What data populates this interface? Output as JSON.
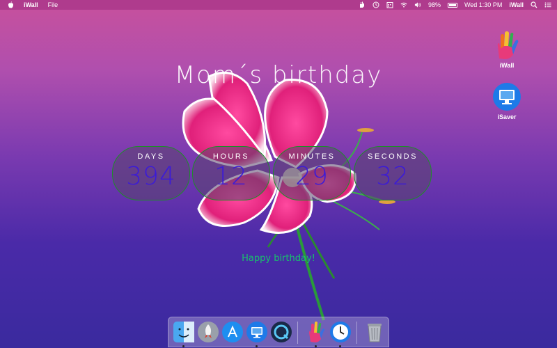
{
  "menubar": {
    "apple_icon": "apple-icon",
    "app_name": "iWall",
    "menus": [
      "File"
    ],
    "status": {
      "battery": "98%",
      "clock": "Wed 1:30 PM",
      "app_label": "iWall"
    }
  },
  "countdown": {
    "title": "Mom´s birthday",
    "units": [
      {
        "label": "DAYS",
        "value": "394"
      },
      {
        "label": "HOURS",
        "value": "12"
      },
      {
        "label": "MINUTES",
        "value": "29"
      },
      {
        "label": "SECONDS",
        "value": "32"
      }
    ],
    "message": "Happy  birthday!"
  },
  "desktop": {
    "icons": [
      {
        "label": "iWall",
        "icon": "iwall-hand-icon"
      },
      {
        "label": "iSaver",
        "icon": "isaver-monitor-icon"
      }
    ]
  },
  "dock": {
    "items": [
      "finder-icon",
      "launchpad-icon",
      "app-store-icon",
      "isaver-icon",
      "quicktime-icon",
      "iwall-icon",
      "clock-icon",
      "trash-icon"
    ]
  },
  "colors": {
    "menubar": "#ac3a8c",
    "counter_border": "#1f8c2a",
    "counter_value": "#3b1bd8",
    "message": "#18c26c"
  }
}
